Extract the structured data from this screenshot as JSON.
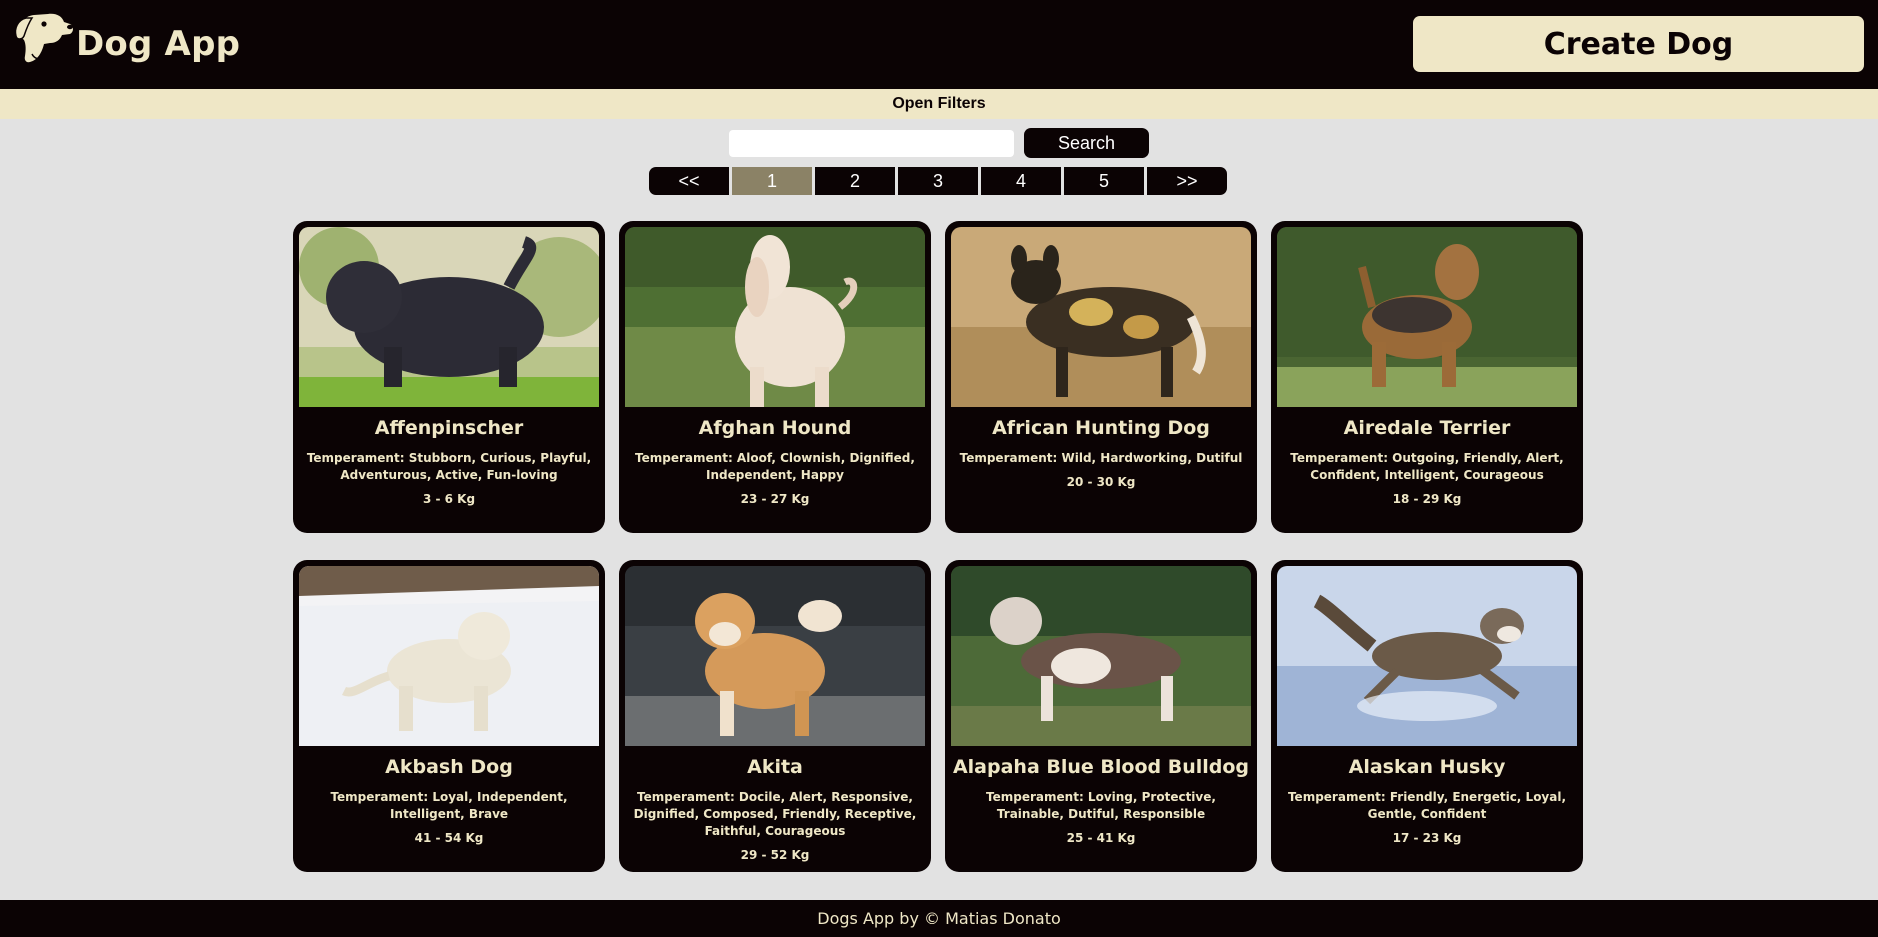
{
  "header": {
    "app_title": "Dog App",
    "logo_icon": "dog-head-icon",
    "create_button": "Create Dog"
  },
  "filters": {
    "toggle_label": "Open Filters"
  },
  "search": {
    "value": "",
    "placeholder": "",
    "button_label": "Search"
  },
  "pagination": {
    "first": "<<",
    "pages": [
      "1",
      "2",
      "3",
      "4",
      "5"
    ],
    "last": ">>",
    "active_page": "1"
  },
  "dogs": [
    {
      "name": "Affenpinscher",
      "temperament": "Temperament: Stubborn, Curious, Playful, Adventurous, Active, Fun-loving",
      "weight": "3 - 6 Kg"
    },
    {
      "name": "Afghan Hound",
      "temperament": "Temperament: Aloof, Clownish, Dignified, Independent, Happy",
      "weight": "23 - 27 Kg"
    },
    {
      "name": "African Hunting Dog",
      "temperament": "Temperament: Wild, Hardworking, Dutiful",
      "weight": "20 - 30 Kg"
    },
    {
      "name": "Airedale Terrier",
      "temperament": "Temperament: Outgoing, Friendly, Alert, Confident, Intelligent, Courageous",
      "weight": "18 - 29 Kg"
    },
    {
      "name": "Akbash Dog",
      "temperament": "Temperament: Loyal, Independent, Intelligent, Brave",
      "weight": "41 - 54 Kg"
    },
    {
      "name": "Akita",
      "temperament": "Temperament: Docile, Alert, Responsive, Dignified, Composed, Friendly, Receptive, Faithful, Courageous",
      "weight": "29 - 52 Kg"
    },
    {
      "name": "Alapaha Blue Blood Bulldog",
      "temperament": "Temperament: Loving, Protective, Trainable, Dutiful, Responsible",
      "weight": "25 - 41 Kg"
    },
    {
      "name": "Alaskan Husky",
      "temperament": "Temperament: Friendly, Energetic, Loyal, Gentle, Confident",
      "weight": "17 - 23 Kg"
    }
  ],
  "footer": {
    "text": "Dogs App by © Matias Donato"
  },
  "colors": {
    "header_bg": "#0b0304",
    "accent_cream": "#efe7c6",
    "page_bg": "#e2e2e2",
    "active_page": "#8b8266"
  }
}
